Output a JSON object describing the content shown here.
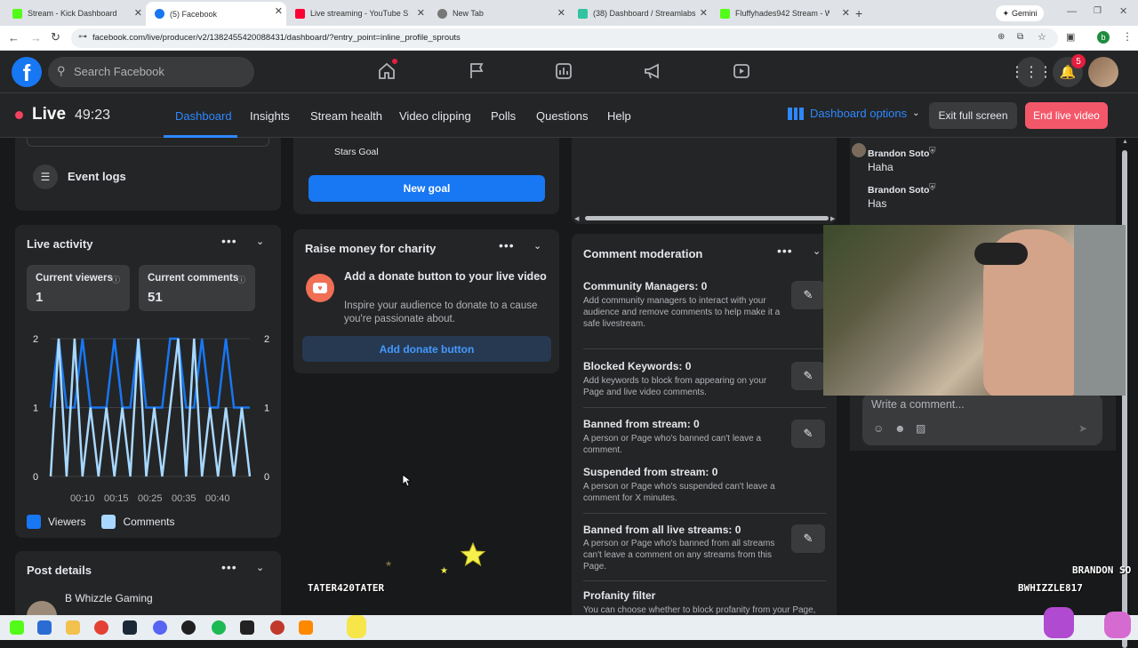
{
  "browser": {
    "tabs": [
      {
        "title": "Stream - Kick Dashboard",
        "color": "#53fc18"
      },
      {
        "title": "(5) Facebook",
        "color": "#1877f2"
      },
      {
        "title": "Live streaming - YouTube Studio",
        "color": "#ff0033"
      },
      {
        "title": "New Tab",
        "color": "#666"
      },
      {
        "title": "(38) Dashboard / Streamlabs",
        "color": "#31c3a2"
      },
      {
        "title": "Fluffyhades942 Stream - W",
        "color": "#53fc18"
      }
    ],
    "gemini": "Gemini",
    "url": "facebook.com/live/producer/v2/1382455420088431/dashboard/?entry_point=inline_profile_sprouts",
    "profile_initial": "b"
  },
  "facebook": {
    "search_placeholder": "Search Facebook",
    "notif_count": "5"
  },
  "live": {
    "label": "Live",
    "timer": "49:23",
    "nav": [
      "Dashboard",
      "Insights",
      "Stream health",
      "Video clipping",
      "Polls",
      "Questions",
      "Help"
    ],
    "dashboard_options": "Dashboard options",
    "exit_fullscreen": "Exit full screen",
    "end_live": "End live video"
  },
  "left": {
    "event_logs": "Event logs",
    "live_activity_title": "Live activity",
    "current_viewers_label": "Current viewers",
    "current_viewers": "1",
    "current_comments_label": "Current comments",
    "current_comments": "51",
    "legend_viewers": "Viewers",
    "legend_comments": "Comments",
    "post_details": "Post details",
    "page_name": "B Whizzle Gaming"
  },
  "chart_data": {
    "type": "line",
    "x_ticks": [
      "00:10",
      "00:15",
      "00:25",
      "00:35",
      "00:40"
    ],
    "y_ticks": [
      0,
      1,
      2
    ],
    "ylim": [
      0,
      2
    ],
    "series": [
      {
        "name": "Viewers",
        "color": "#1877f2",
        "values": [
          1,
          2,
          1,
          1,
          2,
          1,
          1,
          1,
          2,
          1,
          1,
          2,
          1,
          1,
          1,
          2,
          2,
          1,
          1,
          2,
          1,
          1,
          2,
          1,
          1,
          1
        ]
      },
      {
        "name": "Comments",
        "color": "#a8d8ff",
        "values": [
          0,
          2,
          0,
          2,
          0,
          1,
          0,
          1,
          0,
          1,
          0,
          2,
          0,
          1,
          0,
          1,
          2,
          0,
          2,
          0,
          1,
          0,
          1,
          0,
          1,
          0
        ]
      }
    ]
  },
  "middle": {
    "stars_goal": "Stars Goal",
    "new_goal": "New goal",
    "charity_title": "Raise money for charity",
    "donate_heading": "Add a donate button to your live video",
    "donate_desc": "Inspire your audience to donate to a cause you're passionate about.",
    "donate_button": "Add donate button",
    "overlay_name": "TATER420TATER"
  },
  "moderation": {
    "title": "Comment moderation",
    "items": [
      {
        "title": "Community Managers: 0",
        "desc": "Add community managers to interact with your audience and remove comments to help make it a safe livestream."
      },
      {
        "title": "Blocked Keywords: 0",
        "desc": "Add keywords to block from appearing on your Page and live video comments."
      },
      {
        "title": "Banned from stream: 0",
        "desc": "A person or Page who's banned can't leave a comment."
      },
      {
        "title": "Suspended from stream: 0",
        "desc": "A person or Page who's suspended can't leave a comment for X minutes."
      },
      {
        "title": "Banned from all live streams: 0",
        "desc": "A person or Page who's banned from all streams can't leave a comment on any streams from this Page."
      },
      {
        "title": "Profanity filter",
        "desc": "You can choose whether to block profanity from your Page,"
      }
    ]
  },
  "comments": [
    {
      "name": "Brandon Soto",
      "text": "Haha"
    },
    {
      "name": "Brandon Soto",
      "text": "Has"
    }
  ],
  "write_comment_placeholder": "Write a comment...",
  "overlay_right": {
    "line1": "BRANDON SO",
    "line2": "BWHIZZLE817"
  }
}
